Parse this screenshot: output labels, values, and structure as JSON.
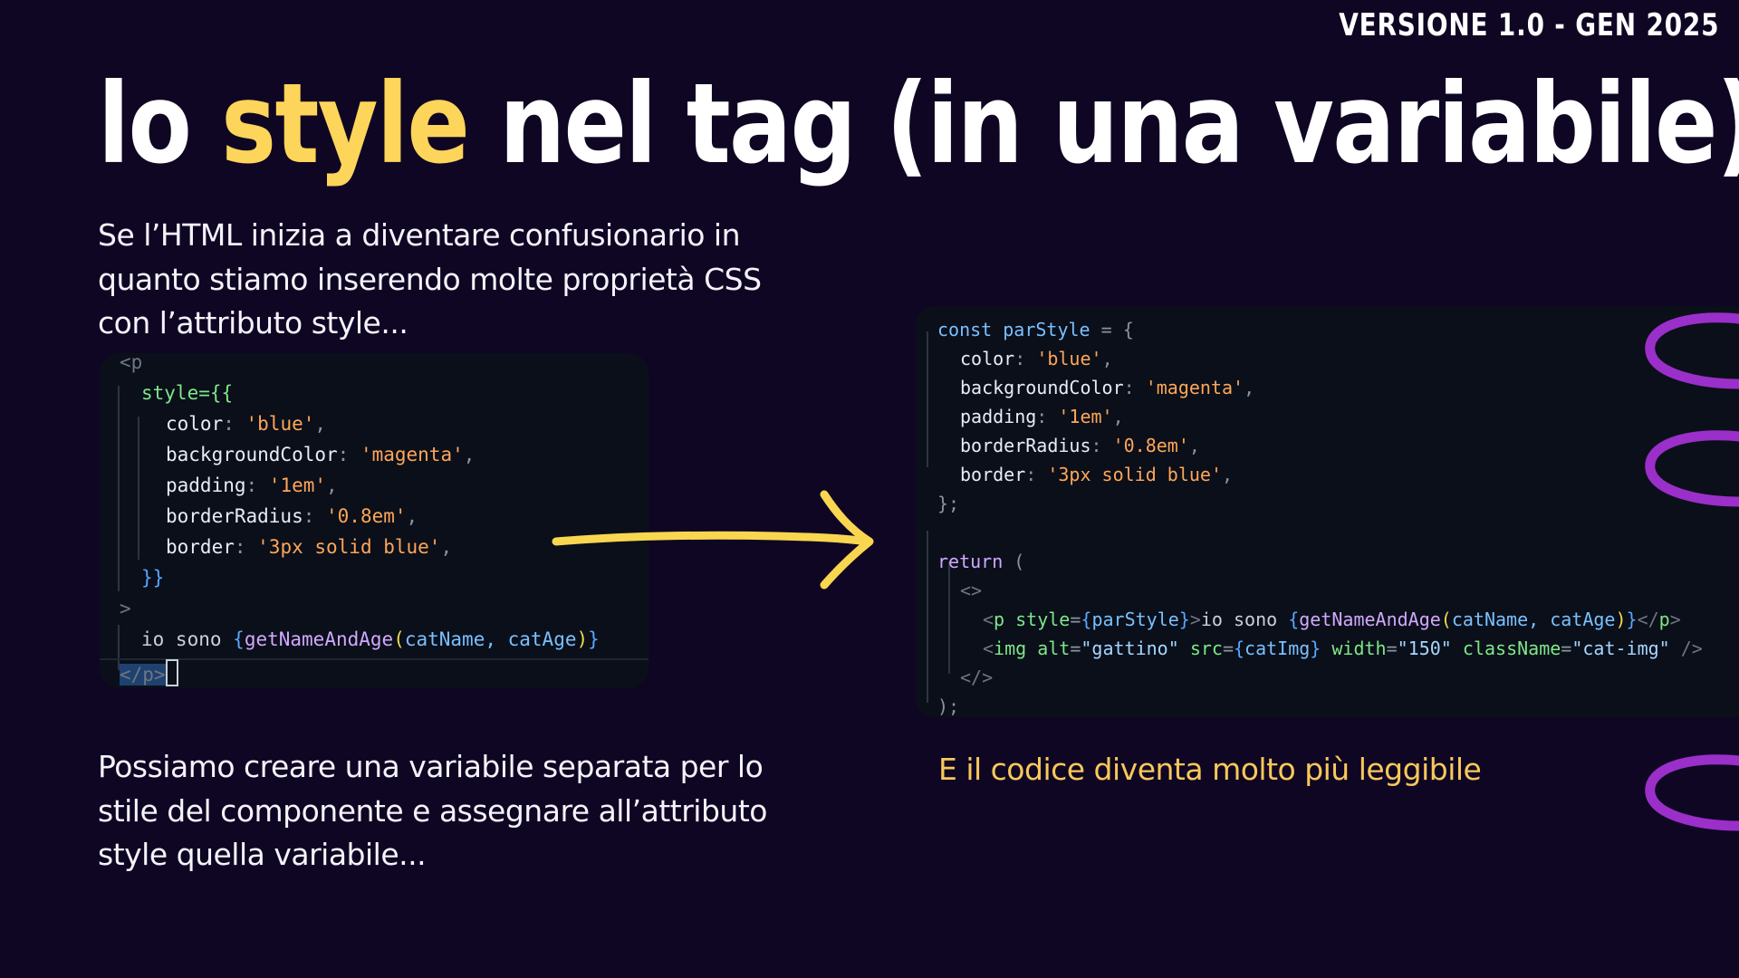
{
  "header": {
    "version": "VERSIONE 1.0 - GEN 2025"
  },
  "title": {
    "prefix": "lo ",
    "highlight": "style",
    "suffix": " nel tag (in una variabile)"
  },
  "text": {
    "intro": "Se l’HTML inizia a diventare confusionario in quanto stiamo inserendo molte proprietà CSS con l’attributo style...",
    "explanation": "Possiamo creare una variabile separata per lo stile del componente e assegnare all’attributo style quella variabile...",
    "conclusion": "E il codice diventa molto più leggibile"
  },
  "code_before": {
    "open_tag": "<p",
    "style_open": "style={{",
    "props": [
      {
        "key": "color",
        "value": "'blue'"
      },
      {
        "key": "backgroundColor",
        "value": "'magenta'"
      },
      {
        "key": "padding",
        "value": "'1em'"
      },
      {
        "key": "borderRadius",
        "value": "'0.8em'"
      },
      {
        "key": "border",
        "value": "'3px solid blue'"
      }
    ],
    "style_close": "}}",
    "tag_close": ">",
    "content_text": "io sono ",
    "content_expr_fn": "getNameAndAge",
    "content_expr_args": "catName, catAge",
    "close_tag": "</p>"
  },
  "code_after": {
    "decl_keyword": "const",
    "var_name": "parStyle",
    "decl_open": " = {",
    "props": [
      {
        "key": "color",
        "value": "'blue'"
      },
      {
        "key": "backgroundColor",
        "value": "'magenta'"
      },
      {
        "key": "padding",
        "value": "'1em'"
      },
      {
        "key": "borderRadius",
        "value": "'0.8em'"
      },
      {
        "key": "border",
        "value": "'3px solid blue'"
      }
    ],
    "decl_close": "};",
    "return_keyword": "return",
    "return_open": " (",
    "fragment_open": "<>",
    "p_line": {
      "attr": "style",
      "value": "parStyle",
      "text": "io sono ",
      "fn": "getNameAndAge",
      "args": "catName, catAge"
    },
    "img_line": {
      "alt": "\"gattino\"",
      "src": "catImg",
      "width": "\"150\"",
      "className": "\"cat-img\""
    },
    "fragment_close": "</>",
    "return_close": ");"
  },
  "colors": {
    "background": "#0f0624",
    "highlight": "#fdd55a",
    "arrow": "#f9d64f",
    "loops": "#9b2fc9",
    "conclusion": "#f8c85a"
  },
  "icons": {
    "arrow": "hand-drawn-arrow-right-icon",
    "loops": "purple-loop-decoration-icon"
  }
}
